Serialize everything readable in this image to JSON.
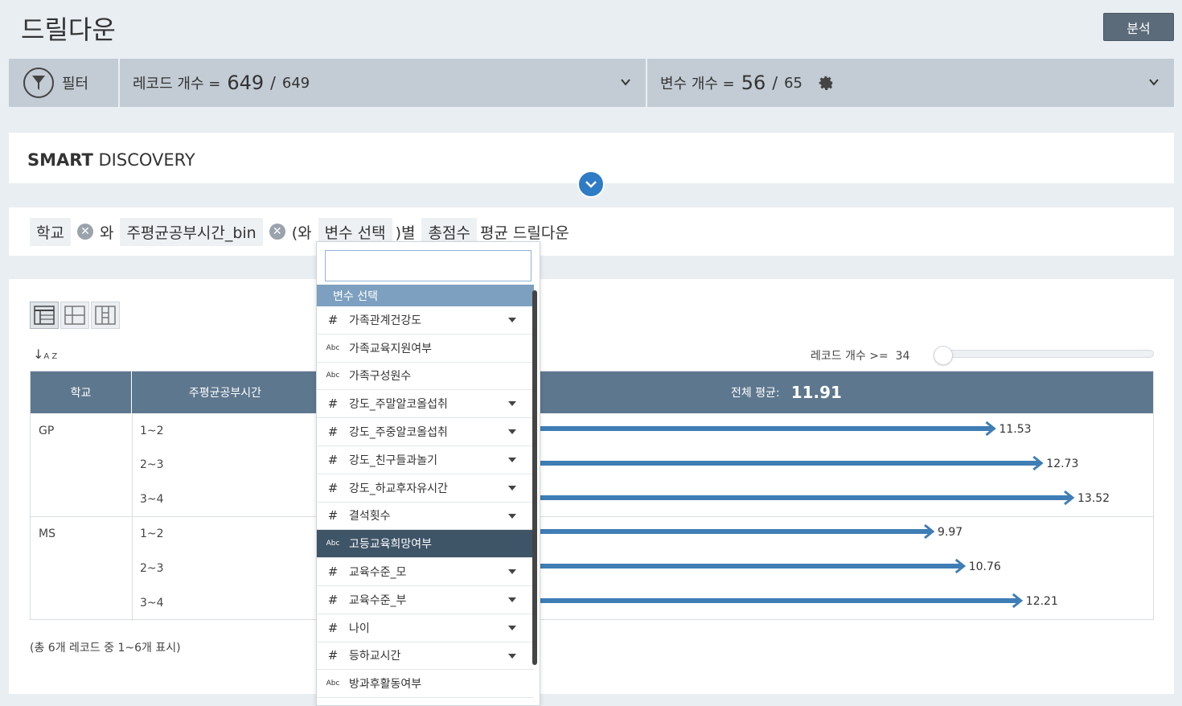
{
  "page": {
    "title": "드릴다운",
    "analyze_label": "분석"
  },
  "filter_bar": {
    "filter_label": "필터",
    "records_label": "레코드 개수 =",
    "records_selected": "649",
    "records_sep": "/",
    "records_total": "649",
    "vars_label": "변수 개수 =",
    "vars_selected": "56",
    "vars_sep": "/",
    "vars_total": "65"
  },
  "smart_discovery": {
    "title_bold": "SMART",
    "title_rest": "DISCOVERY"
  },
  "query": {
    "chip1": "학교",
    "and1": "와",
    "chip2": "주평균공부시간_bin",
    "paren_open": "(와",
    "chip3": "변수 선택",
    "paren_close": ")별",
    "chip4": "총점수",
    "tail": "평균 드릴다운"
  },
  "table_controls": {
    "record_filter_label": "레코드 개수 >=",
    "record_filter_value": "34",
    "record_filter_level": 0
  },
  "table": {
    "headers": {
      "col1": "학교",
      "col2": "주평균공부시간",
      "avg_label": "전체 평균:",
      "avg_value": "11.91"
    },
    "groups": [
      {
        "school": "GP",
        "bins": [
          "1~2",
          "2~3",
          "3~4"
        ]
      },
      {
        "school": "MS",
        "bins": [
          "1~2",
          "2~3",
          "3~4"
        ]
      }
    ],
    "footer": "(총 6개 레코드 중 1~6개 표시)"
  },
  "chart_data": {
    "type": "bar",
    "orientation": "horizontal",
    "categories": [
      "GP 1~2",
      "GP 2~3",
      "GP 3~4",
      "MS 1~2",
      "MS 2~3",
      "MS 3~4"
    ],
    "values": [
      11.53,
      12.73,
      13.52,
      9.97,
      10.76,
      12.21
    ],
    "value_labels": [
      "11.53",
      "12.73",
      "13.52",
      "9.97",
      "10.76",
      "12.21"
    ],
    "bar_color": "#3f7db5"
  },
  "dropdown": {
    "search_value": "",
    "header": "변수 선택",
    "items": [
      {
        "type": "#",
        "label": "가족관계건강도",
        "caret": true
      },
      {
        "type": "Abc",
        "label": "가족교육지원여부",
        "caret": false
      },
      {
        "type": "Abc",
        "label": "가족구성원수",
        "caret": false
      },
      {
        "type": "#",
        "label": "강도_주말알코올섭취",
        "caret": true
      },
      {
        "type": "#",
        "label": "강도_주중알코올섭취",
        "caret": true
      },
      {
        "type": "#",
        "label": "강도_친구들과놀기",
        "caret": true
      },
      {
        "type": "#",
        "label": "강도_하교후자유시간",
        "caret": true
      },
      {
        "type": "#",
        "label": "결석횟수",
        "caret": true
      },
      {
        "type": "Abc",
        "label": "고등교육희망여부",
        "caret": false
      },
      {
        "type": "#",
        "label": "교육수준_모",
        "caret": true
      },
      {
        "type": "#",
        "label": "교육수준_부",
        "caret": true
      },
      {
        "type": "#",
        "label": "나이",
        "caret": true
      },
      {
        "type": "#",
        "label": "등하교시간",
        "caret": true
      },
      {
        "type": "Abc",
        "label": "방과후활동여부",
        "caret": false
      }
    ]
  },
  "colors": {
    "header_bg": "#5d778e",
    "accent": "#2e7bc6",
    "selected_item": "#3e5467"
  }
}
